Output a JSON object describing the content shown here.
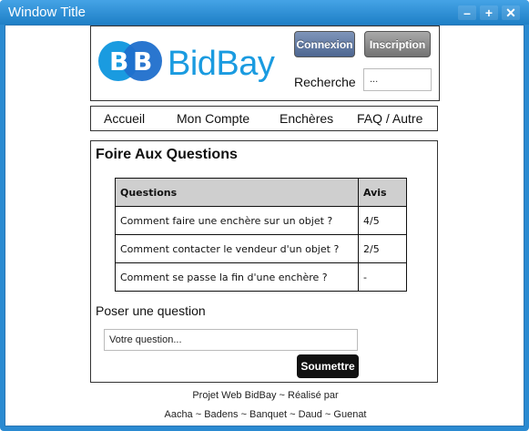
{
  "window": {
    "title": "Window Title",
    "controls": {
      "minimize": "–",
      "maximize": "+",
      "close": "✕"
    }
  },
  "header": {
    "logo_text": "BidBay",
    "logo_letters": "BB",
    "login_button": "Connexion",
    "signup_button": "Inscription",
    "search_label": "Recherche",
    "search_value": "..."
  },
  "nav": {
    "items": [
      {
        "label": "Accueil"
      },
      {
        "label": "Mon Compte"
      },
      {
        "label": "Enchères"
      },
      {
        "label": "FAQ / Autre"
      }
    ]
  },
  "faq": {
    "title": "Foire Aux Questions",
    "columns": [
      "Questions",
      "Avis"
    ],
    "rows": [
      {
        "question": "Comment faire une enchère sur un objet ?",
        "rating": "4/5"
      },
      {
        "question": "Comment contacter le vendeur d'un objet ?",
        "rating": "2/5"
      },
      {
        "question": "Comment se passe la fin d'une enchère ?",
        "rating": "-"
      }
    ]
  },
  "ask": {
    "label": "Poser une question",
    "placeholder": "Votre question...",
    "submit_label": "Soumettre"
  },
  "footer": {
    "line1": "Projet Web BidBay ~ Réalisé par",
    "line2": "Aacha ~ Badens ~ Banquet ~ Daud ~ Guenat"
  },
  "colors": {
    "titlebar": "#2a8ad1",
    "logo_blue": "#1a9be0",
    "login_button": "#5a73a0",
    "signup_button": "#8a8a8a",
    "submit_button": "#111111"
  }
}
